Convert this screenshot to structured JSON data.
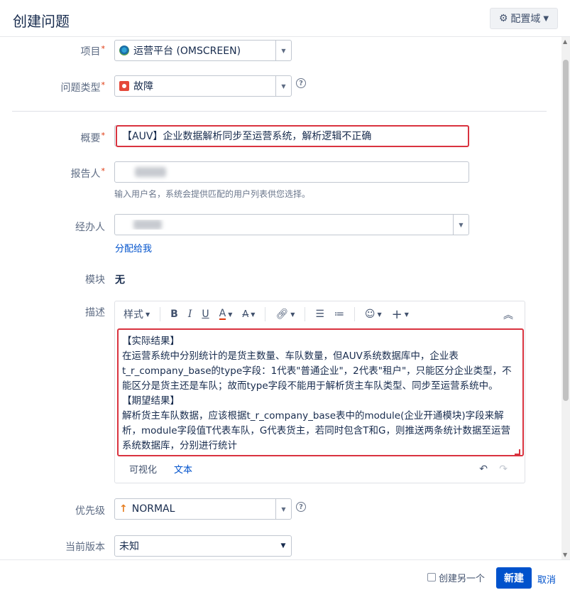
{
  "dialog": {
    "title": "创建问题",
    "config_button": "配置域"
  },
  "fields": {
    "project": {
      "label": "项目",
      "value": "运营平台 (OMSCREEN)",
      "icon": "project-icon"
    },
    "issue_type": {
      "label": "问题类型",
      "value": "故障",
      "icon": "bug-icon"
    },
    "summary": {
      "label": "概要",
      "value": "【AUV】企业数据解析同步至运营系统，解析逻辑不正确"
    },
    "reporter": {
      "label": "报告人",
      "hint": "输入用户名，系统会提供匹配的用户列表供您选择。"
    },
    "assignee": {
      "label": "经办人",
      "assign_to_me": "分配给我"
    },
    "component": {
      "label": "模块",
      "value": "无"
    },
    "description": {
      "label": "描述",
      "toolbar": {
        "style": "样式",
        "bold": "B",
        "italic": "I",
        "underline": "U",
        "text_color": "A",
        "more_format": "A"
      },
      "content": "【实际结果】\n在运营系统中分别统计的是货主数量、车队数量，但AUV系统数据库中，企业表t_r_company_base的type字段：1代表\"普通企业\"，2代表\"租户\"，只能区分企业类型，不能区分是货主还是车队；故而type字段不能用于解析货主车队类型、同步至运营系统中。\n【期望结果】\n解析货主车队数据，应该根据t_r_company_base表中的module(企业开通模块)字段来解析，module字段值T代表车队，G代表货主，若同时包含T和G，则推送两条统计数据至运营系统数据库，分别进行统计",
      "mode_visual": "可视化",
      "mode_text": "文本"
    },
    "priority": {
      "label": "优先级",
      "value": "NORMAL"
    },
    "version": {
      "label": "当前版本",
      "value": "未知"
    }
  },
  "footer": {
    "create_another": "创建另一个",
    "create_button": "新建",
    "cancel": "取消"
  },
  "colors": {
    "accent": "#0052cc",
    "highlight_box": "#d9333f",
    "required": "#de350b"
  }
}
